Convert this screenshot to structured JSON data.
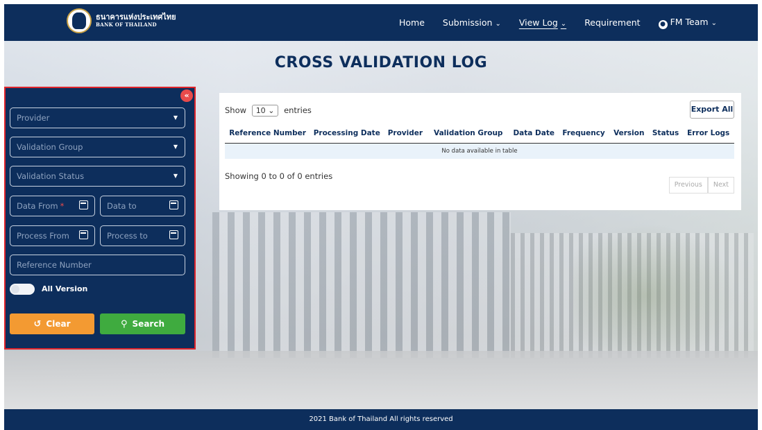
{
  "brand": {
    "thai_name": "ธนาคารแห่งประเทศไทย",
    "english_name": "BANK OF THAILAND"
  },
  "nav": {
    "items": [
      {
        "label": "Home",
        "has_caret": false
      },
      {
        "label": "Submission",
        "has_caret": true
      },
      {
        "label": "View Log",
        "has_caret": true,
        "active": true
      },
      {
        "label": "Requirement",
        "has_caret": false
      }
    ],
    "user": {
      "label": "FM Team",
      "icon": "user-icon"
    }
  },
  "page": {
    "title": "CROSS VALIDATION LOG"
  },
  "filters": {
    "provider": "Provider",
    "validation_group": "Validation Group",
    "validation_status": "Validation Status",
    "data_from": "Data From",
    "data_from_required": "*",
    "data_to": "Data to",
    "process_from": "Process From",
    "process_to": "Process to",
    "reference_number": "Reference Number",
    "all_version": "All Version",
    "clear_label": "Clear",
    "search_label": "Search",
    "collapse_icon": "«"
  },
  "table": {
    "show_label": "Show",
    "entries_value": "10",
    "entries_label": "entries",
    "export_label": "Export All",
    "columns": [
      "Reference Number",
      "Processing Date",
      "Provider",
      "Validation Group",
      "Data Date",
      "Frequency",
      "Version",
      "Status",
      "Error Logs"
    ],
    "empty_message": "No data available in table",
    "info": "Showing 0 to 0 of 0 entries",
    "previous_label": "Previous",
    "next_label": "Next"
  },
  "footer": {
    "text": "2021 Bank of Thailand All rights reserved"
  },
  "colors": {
    "navy": "#0d2e5c",
    "clear": "#f39a32",
    "search": "#3fab3f",
    "highlight": "#e0242b"
  }
}
